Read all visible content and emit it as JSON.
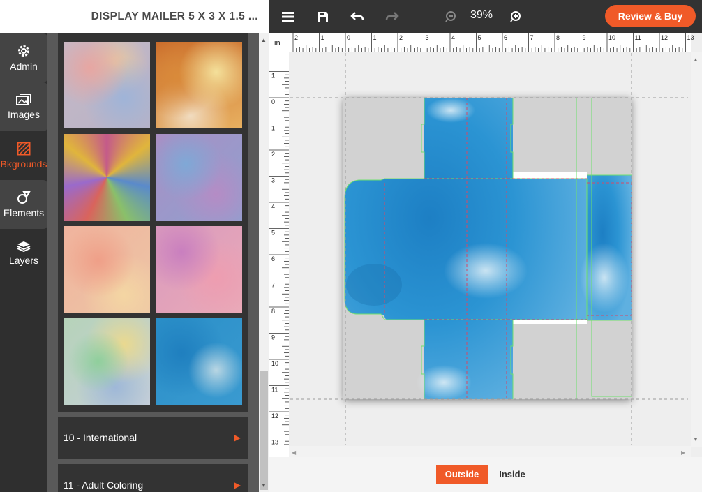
{
  "document": {
    "title": "DISPLAY MAILER 5 X 3 X 1.5 ..."
  },
  "toolbar": {
    "zoom": "39%",
    "review_buy_label": "Review & Buy"
  },
  "nav": {
    "items": [
      {
        "label": "Admin",
        "icon": "gear-icon"
      },
      {
        "label": "Images",
        "icon": "images-icon"
      },
      {
        "label": "Bkgrounds",
        "icon": "backgrounds-icon"
      },
      {
        "label": "Elements",
        "icon": "elements-icon"
      },
      {
        "label": "Layers",
        "icon": "layers-icon"
      }
    ],
    "active": "Bkgrounds"
  },
  "backgrounds": {
    "thumbnails": [
      {
        "name": "pastel-watercolor"
      },
      {
        "name": "orange-yellow-watercolor"
      },
      {
        "name": "kaleidoscope"
      },
      {
        "name": "purple-blue-watercolor"
      },
      {
        "name": "peach-pink-watercolor"
      },
      {
        "name": "pink-purple-watercolor"
      },
      {
        "name": "green-yellow-watercolor"
      },
      {
        "name": "blue-watercolor"
      }
    ],
    "categories": [
      {
        "label": "10 - International"
      },
      {
        "label": "11 - Adult Coloring"
      }
    ]
  },
  "ruler": {
    "unit": "in",
    "top_labels": [
      "2",
      "1",
      "0",
      "1",
      "2",
      "3",
      "4",
      "5",
      "6",
      "7",
      "8",
      "9",
      "10",
      "11",
      "12",
      "13"
    ],
    "left_labels": [
      "1",
      "0",
      "1",
      "2",
      "3",
      "4",
      "5",
      "6",
      "7",
      "8",
      "9",
      "10",
      "11",
      "12",
      "13"
    ]
  },
  "view": {
    "outside_label": "Outside",
    "inside_label": "Inside",
    "selected": "Outside"
  },
  "colors": {
    "accent": "#f05a28",
    "toolbar": "#333333",
    "nav": "#2f2f2f",
    "panel": "#595959"
  }
}
